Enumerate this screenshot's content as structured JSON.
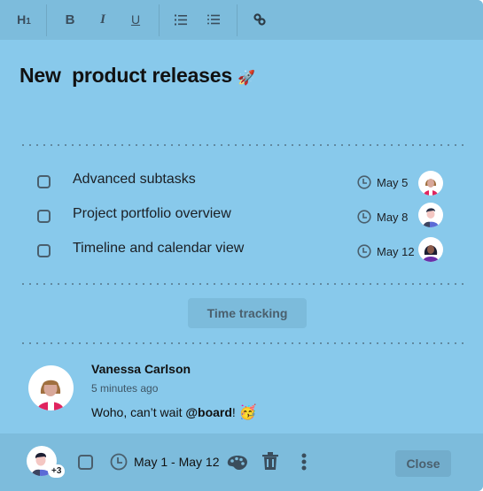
{
  "toolbar": {
    "buttons": [
      {
        "name": "heading-1",
        "label": "H1"
      },
      {
        "name": "bold",
        "label": "B"
      },
      {
        "name": "italic",
        "label": "I"
      },
      {
        "name": "underline",
        "label": "U"
      },
      {
        "name": "ordered-list",
        "label": "numbered-list-icon"
      },
      {
        "name": "bullet-list",
        "label": "bullet-list-icon"
      },
      {
        "name": "link",
        "label": "link-icon"
      }
    ],
    "h1_label": "H",
    "h1_sub": "1",
    "bold_label": "B",
    "italic_label": "I",
    "underline_label": "U"
  },
  "card": {
    "title": "New  product releases",
    "title_emoji": "🚀"
  },
  "tasks": [
    {
      "label": "Advanced subtasks",
      "due": "May 5",
      "checked": false
    },
    {
      "label": "Project portfolio overview",
      "due": "May 8",
      "checked": false
    },
    {
      "label": "Timeline and calendar view",
      "due": "May 12",
      "checked": false
    }
  ],
  "time_tracking": {
    "label": "Time tracking"
  },
  "comment": {
    "author": "Vanessa Carlson",
    "time": "5 minutes ago",
    "text_before": "Woho, can’t wait ",
    "mention": "@board",
    "text_after": "!",
    "emoji": "🥳"
  },
  "footer": {
    "extra_members": "+3",
    "date_range": "May 1 - May 12",
    "close_label": "Close"
  },
  "colors": {
    "background": "#88c9eb",
    "toolbar": "#7dbcdc",
    "icon": "#3a4d5c"
  }
}
